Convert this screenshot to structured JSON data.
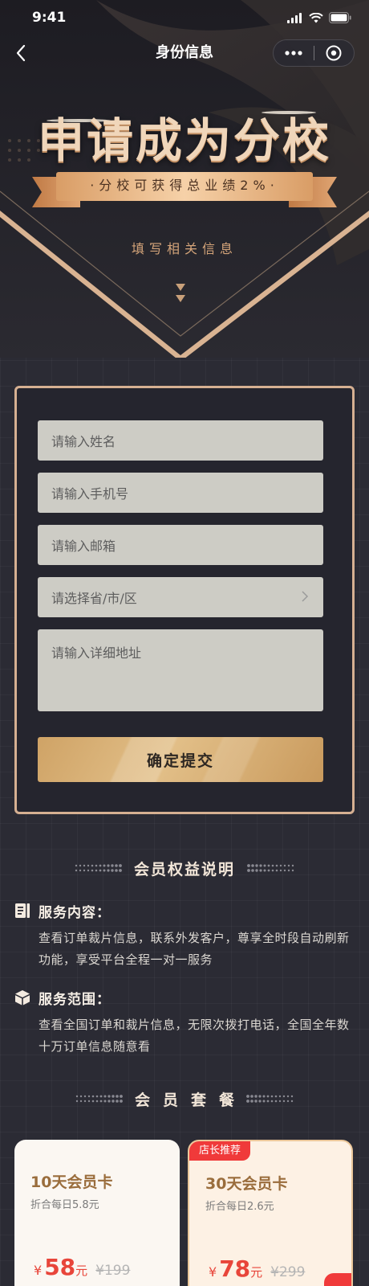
{
  "status_bar": {
    "time": "9:41"
  },
  "nav": {
    "title": "身份信息"
  },
  "hero": {
    "title": "申请成为分校",
    "ribbon": "·分校可获得总业绩2%·",
    "subtitle": "填写相关信息"
  },
  "form": {
    "name_placeholder": "请输入姓名",
    "phone_placeholder": "请输入手机号",
    "email_placeholder": "请输入邮箱",
    "region_placeholder": "请选择省/市/区",
    "address_placeholder": "请输入详细地址",
    "submit_label": "确定提交"
  },
  "benefits": {
    "title": "会员权益说明",
    "items": [
      {
        "icon": "document-icon",
        "title": "服务内容：",
        "desc": "查看订单裁片信息，联系外发客户，尊享全时段自动刷新功能，享受平台全程一对一服务"
      },
      {
        "icon": "box-icon",
        "title": "服务范围：",
        "desc": "查看全国订单和裁片信息，无限次拨打电话，全国全年数十万订单信息随意看"
      }
    ]
  },
  "packages": {
    "title": "会员套餐",
    "items": [
      {
        "name": "10天会员卡",
        "daily": "折合每日5.8元",
        "currency": "¥",
        "price": "58",
        "unit": "元",
        "original": "¥199",
        "badge": ""
      },
      {
        "name": "30天会员卡",
        "daily": "折合每日2.6元",
        "currency": "¥",
        "price": "78",
        "unit": "元",
        "original": "¥299",
        "badge": "店长推荐"
      }
    ]
  },
  "colors": {
    "background": "#2b2b34",
    "gold": "#d6b092",
    "accent_red": "#e8453a",
    "field_bg": "#cdccc5"
  }
}
